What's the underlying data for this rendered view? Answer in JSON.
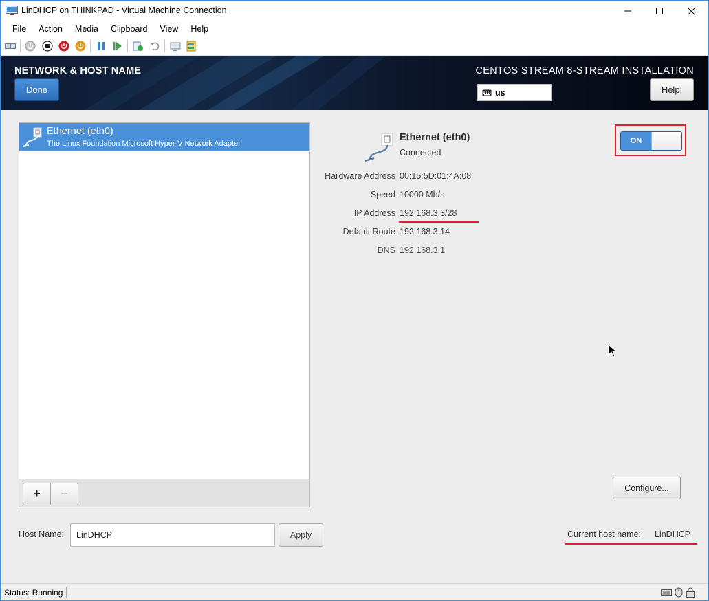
{
  "window": {
    "title": "LinDHCP on THINKPAD - Virtual Machine Connection",
    "controls": [
      "minimize",
      "maximize",
      "close"
    ]
  },
  "menu": [
    "File",
    "Action",
    "Media",
    "Clipboard",
    "View",
    "Help"
  ],
  "toolbar_icons": [
    "ctrl-alt-del-icon",
    "start-icon",
    "turn-off-icon",
    "shut-down-icon",
    "save-icon",
    "pause-icon",
    "resume-icon",
    "checkpoint-icon",
    "revert-icon",
    "enhanced-session-icon",
    "share-icon"
  ],
  "header": {
    "title": "NETWORK & HOST NAME",
    "done_label": "Done",
    "install_title": "CENTOS STREAM 8-STREAM INSTALLATION",
    "keyboard_layout": "us",
    "help_label": "Help!"
  },
  "device_list": {
    "items": [
      {
        "name": "Ethernet (eth0)",
        "description": "The Linux Foundation Microsoft Hyper-V Network Adapter",
        "selected": true
      }
    ],
    "add_label": "+",
    "remove_label": "−"
  },
  "device": {
    "name": "Ethernet (eth0)",
    "status": "Connected",
    "toggle_label": "ON",
    "toggle_on": true,
    "properties": [
      {
        "label": "Hardware Address",
        "value": "00:15:5D:01:4A:08"
      },
      {
        "label": "Speed",
        "value": "10000 Mb/s"
      },
      {
        "label": "IP Address",
        "value": "192.168.3.3/28"
      },
      {
        "label": "Default Route",
        "value": "192.168.3.14"
      },
      {
        "label": "DNS",
        "value": "192.168.3.1"
      }
    ],
    "configure_label": "Configure..."
  },
  "hostname": {
    "label": "Host Name:",
    "value": "LinDHCP",
    "apply_label": "Apply",
    "current_label": "Current host name:",
    "current_value": "LinDHCP"
  },
  "status_bar": {
    "text": "Status: Running"
  },
  "colors": {
    "accent": "#4a90d9",
    "highlight": "#e3202a",
    "header_bg": "#0b0f1e"
  }
}
